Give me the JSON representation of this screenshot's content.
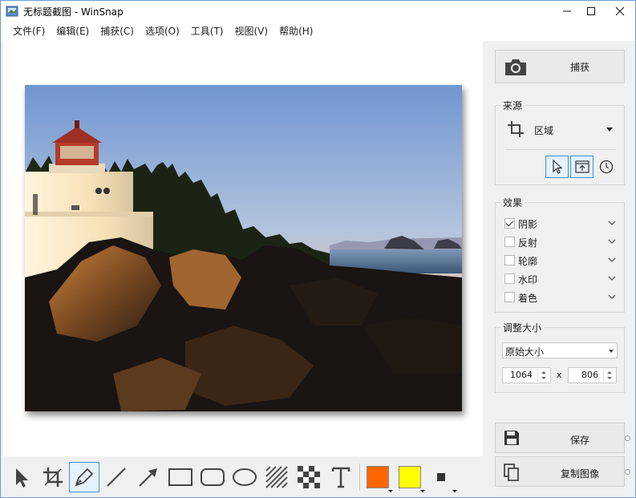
{
  "window": {
    "title": "无标题截图 - WinSnap"
  },
  "menu": {
    "items": [
      "文件(F)",
      "编辑(E)",
      "捕获(C)",
      "选项(O)",
      "工具(T)",
      "视图(V)",
      "帮助(H)"
    ]
  },
  "capture": {
    "label": "捕获"
  },
  "source": {
    "title": "来源",
    "mode": "区域"
  },
  "effects": {
    "title": "效果",
    "items": [
      {
        "label": "阴影",
        "checked": true
      },
      {
        "label": "反射",
        "checked": false
      },
      {
        "label": "轮廓",
        "checked": false
      },
      {
        "label": "水印",
        "checked": false
      },
      {
        "label": "着色",
        "checked": false
      }
    ]
  },
  "resize": {
    "title": "调整大小",
    "mode": "原始大小",
    "width": "1064",
    "separator": "x",
    "height": "806"
  },
  "actions": {
    "save_label": "保存",
    "copy_label": "复制图像"
  },
  "toolbar": {
    "tools": [
      "pointer-icon",
      "crop-icon",
      "pen-icon",
      "line-icon",
      "arrow-icon",
      "rectangle-icon",
      "rounded-rectangle-icon",
      "ellipse-icon",
      "hatch-icon",
      "pixelate-icon",
      "text-icon"
    ],
    "active_tool": "pen-icon",
    "primary_color": "#ff6600",
    "secondary_color": "#ffff00"
  },
  "colors": {
    "accent": "#3f8fd8",
    "window_bg": "#f0f0f0"
  }
}
